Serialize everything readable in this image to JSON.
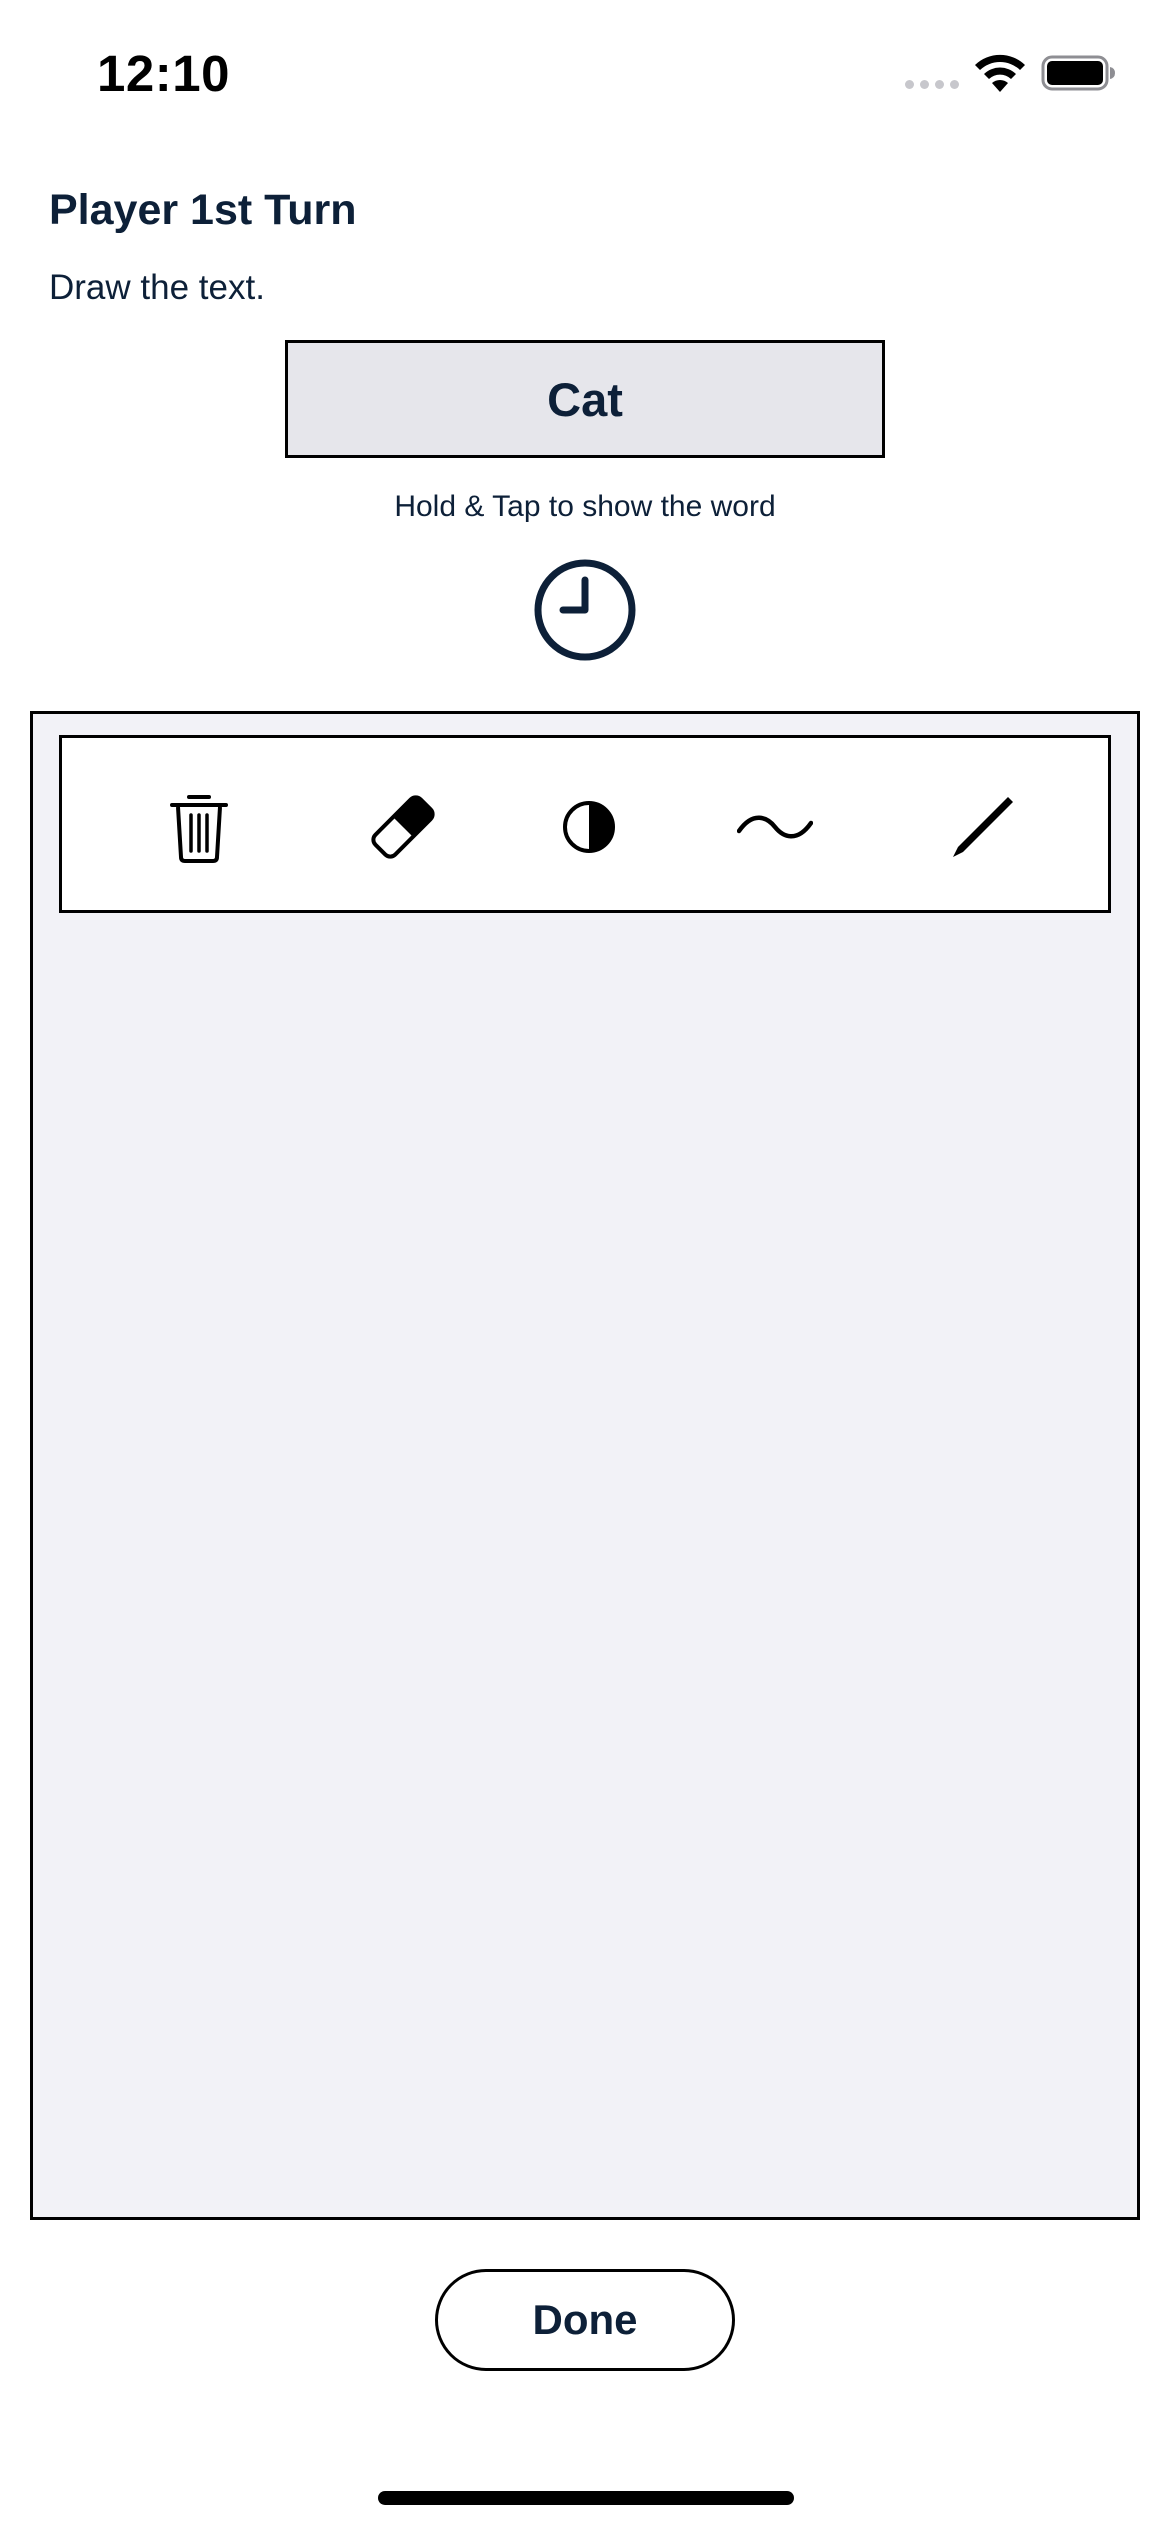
{
  "status_bar": {
    "time": "12:10",
    "icons": [
      "cellular-signal-icon",
      "wifi-icon",
      "battery-icon"
    ]
  },
  "header": {
    "title": "Player 1st Turn",
    "subtitle": "Draw the text."
  },
  "word_card": {
    "word": "Cat",
    "hint": "Hold & Tap to show the word"
  },
  "timer": {
    "icon": "clock-icon"
  },
  "toolbar": {
    "tools": [
      {
        "name": "delete",
        "icon": "trash-icon"
      },
      {
        "name": "eraser",
        "icon": "eraser-icon"
      },
      {
        "name": "opacity",
        "icon": "half-circle-icon"
      },
      {
        "name": "stroke",
        "icon": "wave-icon"
      },
      {
        "name": "pen",
        "icon": "pencil-icon"
      }
    ]
  },
  "footer": {
    "done_label": "Done"
  },
  "colors": {
    "text": "#0d2038",
    "word_card_bg": "#e6e6eb",
    "canvas_bg": "#f2f2f7",
    "border": "#000000"
  }
}
